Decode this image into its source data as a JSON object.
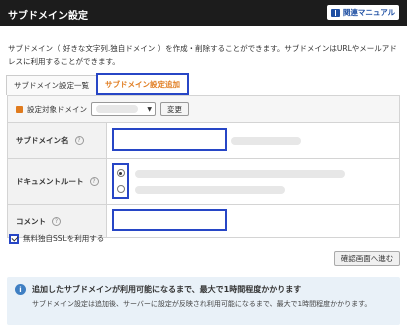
{
  "header": {
    "title": "サブドメイン設定",
    "manual_label": "関連マニュアル"
  },
  "description": "サブドメイン（ 好きな文字列.独自ドメイン ）を作成・削除することができます。サブドメインはURLやメールアドレスに利用することができます。",
  "tabs": [
    {
      "label": "サブドメイン設定一覧",
      "active": false
    },
    {
      "label": "サブドメイン設定追加",
      "active": true
    }
  ],
  "form": {
    "domain_label": "設定対象ドメイン",
    "change_button": "変更",
    "subdomain_label": "サブドメイン名",
    "subdomain_value": "",
    "docroot_label": "ドキュメントルート",
    "comment_label": "コメント",
    "comment_value": "",
    "help_glyph": "?"
  },
  "ssl_label": "無料独自SSLを利用する",
  "ssl_checked": true,
  "confirm_button": "確認画面へ進む",
  "notice": {
    "icon": "i",
    "title": "追加したサブドメインが利用可能になるまで、最大で1時間程度かかります",
    "body": "サブドメイン設定は追加後、サーバーに設定が反映され利用可能になるまで、最大で1時間程度かかります。"
  },
  "colors": {
    "header_bg": "#1c1c1c",
    "highlight": "#2746c6",
    "active_tab_text": "#e07b1e",
    "notice_bg": "#e9f1f8"
  }
}
